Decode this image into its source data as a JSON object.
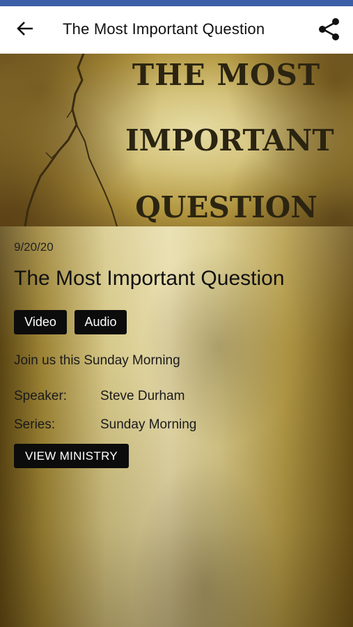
{
  "app_bar": {
    "title": "The Most Important Question",
    "back_icon": "arrow-left-icon",
    "share_icon": "share-icon"
  },
  "hero": {
    "line1": "THE MOST",
    "line2": "IMPORTANT",
    "line3": "QUESTION"
  },
  "sermon": {
    "date": "9/20/20",
    "title": "The Most Important Question",
    "media_buttons": [
      "Video",
      "Audio"
    ],
    "description": "Join us this Sunday Morning",
    "speaker_label": "Speaker:",
    "speaker_value": "Steve Durham",
    "series_label": "Series:",
    "series_value": "Sunday Morning",
    "view_ministry_label": "VIEW MINISTRY"
  },
  "colors": {
    "status_strip": "#3b5fa6",
    "app_bar_bg": "#ffffff",
    "button_bg": "#0c0c0c",
    "button_text": "#ffffff"
  }
}
